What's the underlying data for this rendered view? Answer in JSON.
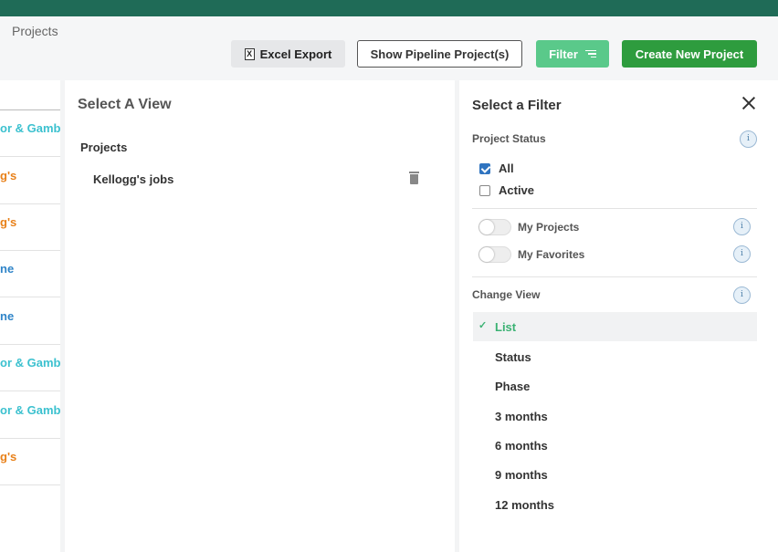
{
  "header": {
    "title": "Projects",
    "excel_export": "Excel Export",
    "excel_icon_letter": "X",
    "show_pipeline": "Show Pipeline Project(s)",
    "filter": "Filter",
    "create_new": "Create New Project"
  },
  "left_list": {
    "rows": [
      {
        "text": "or & Gamble",
        "color": "#3cc1cf"
      },
      {
        "text": "g's",
        "color": "#e8811a"
      },
      {
        "text": "g's",
        "color": "#e8811a"
      },
      {
        "text": "ne",
        "color": "#2f84c8"
      },
      {
        "text": "ne",
        "color": "#2f84c8"
      },
      {
        "text": "or & Gamble",
        "color": "#3cc1cf"
      },
      {
        "text": "or & Gamble",
        "color": "#3cc1cf"
      },
      {
        "text": "g's",
        "color": "#e8811a"
      }
    ]
  },
  "view_panel": {
    "title": "Select A View",
    "section": "Projects",
    "items": [
      {
        "label": "Kellogg's jobs"
      }
    ]
  },
  "filter_panel": {
    "title": "Select a Filter",
    "project_status_label": "Project Status",
    "status_options": [
      {
        "label": "All",
        "checked": true
      },
      {
        "label": "Active",
        "checked": false
      }
    ],
    "toggles": [
      {
        "label": "My Projects",
        "on": false
      },
      {
        "label": "My Favorites",
        "on": false
      }
    ],
    "change_view_label": "Change View",
    "info_glyph": "i",
    "selected_mark": "✓",
    "views": [
      {
        "label": "List",
        "selected": true
      },
      {
        "label": "Status",
        "selected": false
      },
      {
        "label": "Phase",
        "selected": false
      },
      {
        "label": "3 months",
        "selected": false
      },
      {
        "label": "6 months",
        "selected": false
      },
      {
        "label": "9 months",
        "selected": false
      },
      {
        "label": "12 months",
        "selected": false
      }
    ]
  },
  "colors": {
    "topbar": "#1f6b57",
    "filter_button": "#5ac98a",
    "create_button": "#2e9c3e",
    "selected_view": "#3bb273"
  }
}
